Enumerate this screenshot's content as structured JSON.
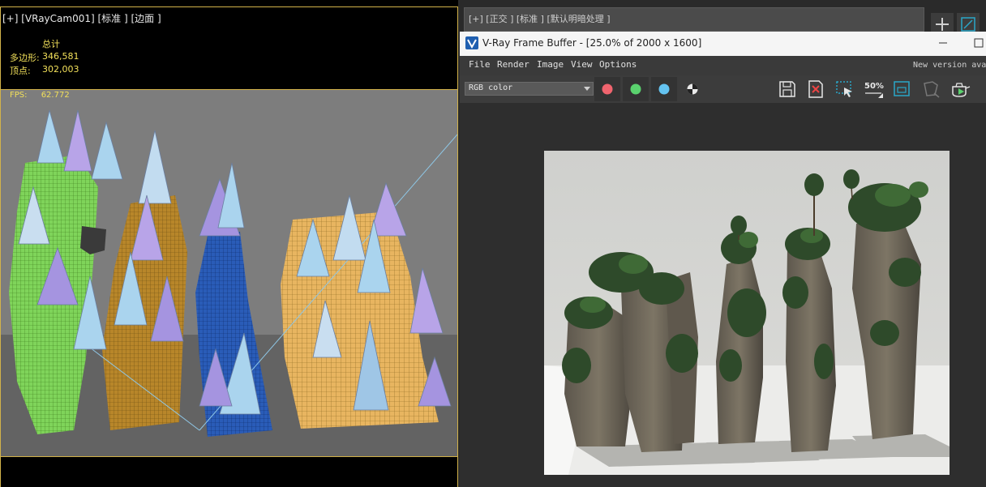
{
  "viewport": {
    "label": "[+] [VRayCam001] [标准 ] [边面 ]",
    "stats_header": "总计",
    "poly_label": "多边形:",
    "poly_value": "346,581",
    "vert_label": "顶点:",
    "vert_value": "302,003",
    "fps_label": "FPS:",
    "fps_value": "62.772"
  },
  "right_viewport": {
    "label": "[+] [正交 ] [标准 ] [默认明暗处理 ]"
  },
  "vfb": {
    "title": "V-Ray Frame Buffer - [25.0% of 2000 x 1600]",
    "menu": [
      "File",
      "Render",
      "Image",
      "View",
      "Options"
    ],
    "new_version": "New version ava",
    "channel": "RGB color",
    "zoom_badge": "50%",
    "colors": {
      "red": "#f0646e",
      "green": "#5ad26e",
      "blue": "#64c3f0",
      "accent": "#2aa6c8"
    }
  }
}
